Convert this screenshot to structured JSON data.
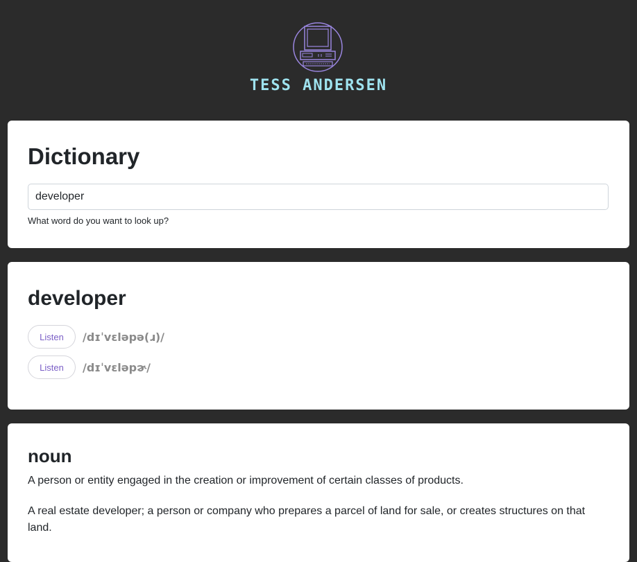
{
  "brand": {
    "name": "TESS ANDERSEN",
    "logo_icon": "retro-computer-icon",
    "accent_color": "#9fe3ef",
    "logo_color": "#9a86e0"
  },
  "search": {
    "title": "Dictionary",
    "value": "developer",
    "help": "What word do you want to look up?"
  },
  "result": {
    "word": "developer",
    "phonetics": [
      {
        "button": "Listen",
        "text": "/dɪˈvɛləpə(ɹ)/"
      },
      {
        "button": "Listen",
        "text": "/dɪˈvɛləpɚ/"
      }
    ]
  },
  "meaning": {
    "part_of_speech": "noun",
    "definitions": [
      "A person or entity engaged in the creation or improvement of certain classes of products.",
      "A real estate developer; a person or company who prepares a parcel of land for sale, or creates structures on that land."
    ]
  }
}
